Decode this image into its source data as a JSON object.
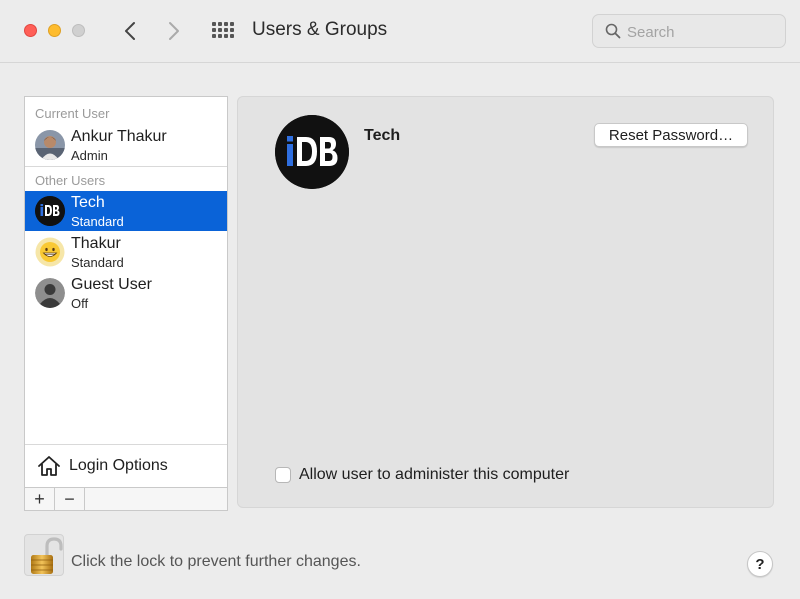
{
  "window": {
    "title": "Users & Groups",
    "search_placeholder": "Search"
  },
  "sidebar": {
    "current_user_heading": "Current User",
    "other_users_heading": "Other Users",
    "current_user": {
      "name": "Ankur Thakur",
      "role": "Admin",
      "avatar": "photo-avatar"
    },
    "other_users": [
      {
        "name": "Tech",
        "role": "Standard",
        "avatar": "idb-logo-avatar",
        "selected": true
      },
      {
        "name": "Thakur",
        "role": "Standard",
        "avatar": "grinning-emoji-avatar",
        "selected": false
      },
      {
        "name": "Guest User",
        "role": "Off",
        "avatar": "generic-person-avatar",
        "selected": false
      }
    ],
    "login_options_label": "Login Options",
    "add_label": "+",
    "remove_label": "−"
  },
  "panel": {
    "avatar_text": "iDB",
    "user_name": "Tech",
    "reset_password_label": "Reset Password…",
    "admin_checkbox_label": "Allow user to administer this computer",
    "admin_checked": false
  },
  "footer": {
    "lock_message": "Click the lock to prevent further changes.",
    "help_label": "?"
  },
  "colors": {
    "selection": "#0a63d8",
    "close": "#ff5f57",
    "minimize": "#febc2e",
    "idb_accent": "#2f6fe0"
  }
}
